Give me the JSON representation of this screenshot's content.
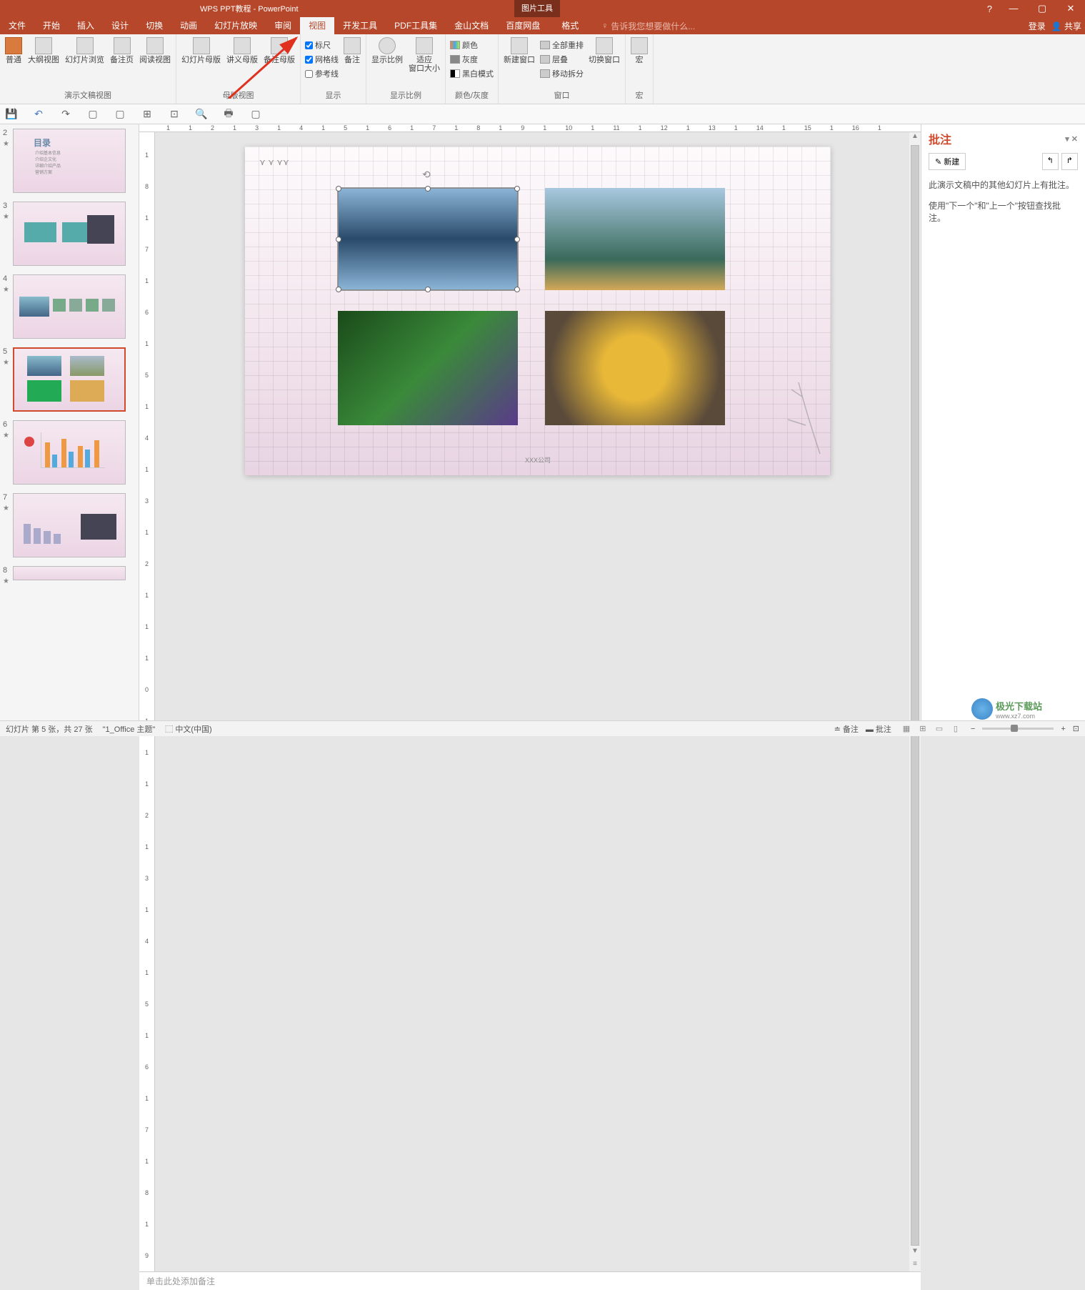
{
  "title": "WPS PPT教程 - PowerPoint",
  "picture_tools": "图片工具",
  "window": {
    "help": "?",
    "min": "—",
    "max": "▢",
    "close": "✕"
  },
  "tabs": {
    "file": "文件",
    "home": "开始",
    "insert": "插入",
    "design": "设计",
    "transition": "切换",
    "animation": "动画",
    "slideshow": "幻灯片放映",
    "review": "审阅",
    "view": "视图",
    "developer": "开发工具",
    "pdftools": "PDF工具集",
    "jinshan": "金山文档",
    "baidu": "百度网盘",
    "format": "格式"
  },
  "tellme": "告诉我您想要做什么...",
  "login": "登录",
  "share": "共享",
  "ribbon": {
    "pres_views": {
      "normal": "普通",
      "outline": "大纲视图",
      "sorter": "幻灯片浏览",
      "notes_page": "备注页",
      "reading": "阅读视图",
      "label": "演示文稿视图"
    },
    "master_views": {
      "slide_master": "幻灯片母版",
      "handout_master": "讲义母版",
      "notes_master": "备注母版",
      "label": "母版视图"
    },
    "show": {
      "ruler": "标尺",
      "gridlines": "网格线",
      "guides": "参考线",
      "notes": "备注",
      "label": "显示"
    },
    "zoom": {
      "zoom": "显示比例",
      "fit": "适应\n窗口大小",
      "label": "显示比例"
    },
    "color": {
      "color": "颜色",
      "gray": "灰度",
      "bw": "黑白模式",
      "label": "颜色/灰度"
    },
    "window": {
      "new": "新建窗口",
      "arrange_all": "全部重排",
      "cascade": "层叠",
      "move_split": "移动拆分",
      "switch": "切换窗口",
      "label": "窗口"
    },
    "macros": {
      "macros": "宏",
      "label": "宏"
    }
  },
  "ruler_marks": [
    "1",
    "1",
    "2",
    "1",
    "3",
    "1",
    "4",
    "1",
    "5",
    "1",
    "6",
    "1",
    "7",
    "1",
    "8",
    "1",
    "9",
    "1",
    "10",
    "1",
    "11",
    "1",
    "12",
    "1",
    "13",
    "1",
    "14",
    "1",
    "15",
    "1",
    "16",
    "1"
  ],
  "ruler_v": [
    "1",
    "8",
    "1",
    "7",
    "1",
    "6",
    "1",
    "5",
    "1",
    "4",
    "1",
    "3",
    "1",
    "2",
    "1",
    "1",
    "1",
    "0",
    "1",
    "1",
    "1",
    "2",
    "1",
    "3",
    "1",
    "4",
    "1",
    "5",
    "1",
    "6",
    "1",
    "7",
    "1",
    "8",
    "1",
    "9"
  ],
  "thumbnails": [
    {
      "num": "2",
      "title": "目录",
      "items": [
        "介绍基本信息",
        "介绍企文化",
        "详细介绍产品",
        "营销方案"
      ]
    },
    {
      "num": "3"
    },
    {
      "num": "4"
    },
    {
      "num": "5",
      "active": true
    },
    {
      "num": "6"
    },
    {
      "num": "7"
    },
    {
      "num": "8"
    }
  ],
  "slide": {
    "footer": "XXX公司"
  },
  "notes_placeholder": "单击此处添加备注",
  "comments": {
    "title": "批注",
    "new": "新建",
    "msg1": "此演示文稿中的其他幻灯片上有批注。",
    "msg2": "使用\"下一个\"和\"上一个\"按钮查找批注。"
  },
  "statusbar": {
    "slide_info": "幻灯片 第 5 张，共 27 张",
    "theme": "\"1_Office 主题\"",
    "lang": "中文(中国)",
    "notes": "备注",
    "comments": "批注",
    "zoom": "+"
  },
  "watermark": "极光下载站",
  "watermark_url": "www.xz7.com"
}
